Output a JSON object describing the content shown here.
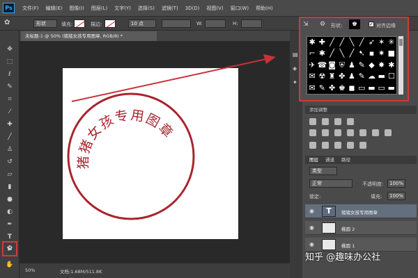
{
  "app": {
    "logo": "Ps"
  },
  "menu": {
    "items": [
      "文件(F)",
      "编辑(E)",
      "图像(I)",
      "图层(L)",
      "文字(Y)",
      "选择(S)",
      "滤镜(T)",
      "3D(D)",
      "视图(V)",
      "窗口(W)",
      "帮助(H)"
    ]
  },
  "options": {
    "shape_mode": "形状",
    "fill_label": "填充:",
    "stroke_label": "描边:",
    "stroke_size": "10 点",
    "w_label": "W:",
    "h_label": "H:",
    "shape_label": "形状:",
    "align_edges": "对齐边缘"
  },
  "document": {
    "tab_title": "未标题-1 @ 50% (猪猪女孩专用图章, RGB/8) *",
    "stamp_text": "猪猪女孩专用图章",
    "stamp_color": "#a8242e",
    "zoom": "50%",
    "doc_info": "文档:1.68M/511.8K"
  },
  "shape_picker": {
    "shapes": [
      "✱",
      "✚",
      "╱",
      "╱",
      "╲",
      "╱",
      "➶",
      "✶",
      "✳",
      "⌐",
      "✱",
      "╱",
      "╲",
      "╱",
      "➷",
      "▪",
      "✷",
      "■",
      "✈",
      "☎",
      "◙",
      "⛨",
      "♟",
      "✎",
      "◆",
      "✸",
      "✱",
      "✉",
      "☢",
      "♜",
      "✤",
      "♟",
      "✎",
      "☁",
      "▬",
      "☐",
      "✉",
      "✎",
      "✤",
      "♚",
      "◼",
      "▭",
      "▬",
      "▭",
      "▬"
    ]
  },
  "panels": {
    "adjustments_title": "添加调整",
    "layers_tabs": [
      "图层",
      "通道",
      "路径"
    ],
    "kind_filter": "类型",
    "blend_mode": "正常",
    "opacity_label": "不透明度:",
    "opacity_value": "100%",
    "lock_label": "锁定:",
    "fill_label": "填充:",
    "fill_value": "100%"
  },
  "layers": [
    {
      "name": "猪猪女孩专用图章",
      "type": "text",
      "selected": true
    },
    {
      "name": "椭圆 2",
      "type": "shape",
      "selected": false
    },
    {
      "name": "椭圆 1",
      "type": "shape",
      "selected": false
    }
  ],
  "watermark": "知乎 @趣味办公社",
  "colors": {
    "highlight": "#d23a3a",
    "arrow": "#c8323a"
  }
}
